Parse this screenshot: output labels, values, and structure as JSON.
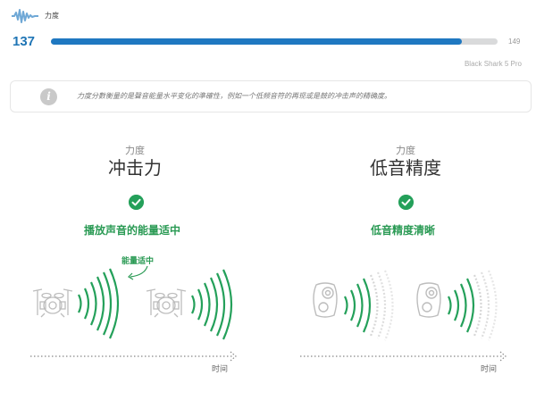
{
  "header": {
    "label": "力度",
    "score": "137",
    "max": "149",
    "progress": 0.919,
    "device": "Black Shark 5 Pro"
  },
  "info": {
    "icon_text": "i",
    "text": "力度分數衡量的是聲音能量水平变化的準確性，例如一个低频音符的再现或是鼓的冲击声的精确度。"
  },
  "panels": [
    {
      "sup": "力度",
      "title": "冲击力",
      "status": "播放声音的能量适中",
      "annotation": "能量适中",
      "time_label": "时间"
    },
    {
      "sup": "力度",
      "title": "低音精度",
      "status": "低音精度清晰",
      "time_label": "时间"
    }
  ],
  "colors": {
    "accent_blue": "#1f78c1",
    "accent_green": "#24a05a",
    "track_gray": "#d9dadb"
  },
  "icons": [
    "waveform-logo-icon",
    "info-icon",
    "check-icon",
    "drum-kit-icon",
    "sound-wave-icon",
    "speaker-cabinet-icon",
    "arrow-right-icon"
  ]
}
